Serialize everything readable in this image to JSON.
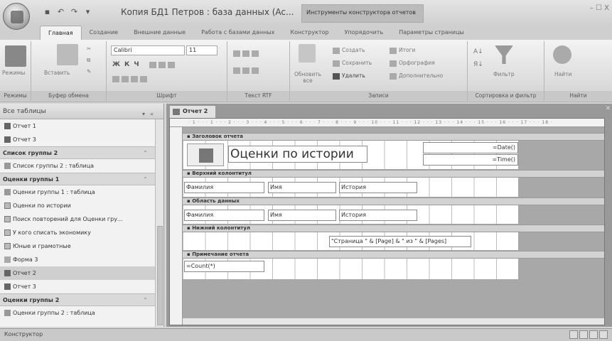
{
  "window": {
    "title": "Копия БД1 Петров : база данных (Ac...",
    "context_tab": "Инструменты конструктора отчетов",
    "controls": "– ☐ X"
  },
  "ribbon_tabs": [
    "Главная",
    "Создание",
    "Внешние данные",
    "Работа с базами данных",
    "Конструктор",
    "Упорядочить",
    "Параметры страницы"
  ],
  "ribbon": {
    "groups": [
      "Режимы",
      "Буфер обмена",
      "Шрифт",
      "Текст RTF",
      "Записи",
      "Сортировка и фильтр",
      "Найти"
    ],
    "rezhimy_btn": "Режимы",
    "vstavit_btn": "Вставить",
    "font_name": "Calibri",
    "font_size": "11",
    "obnovit_btn": "Обновить все",
    "sozdat": "Создать",
    "sohranit": "Сохранить",
    "udalit": "Удалить",
    "itogi": "Итоги",
    "orfografiya": "Орфография",
    "dopolnitelno": "Дополнительно",
    "filtr": "Фильтр",
    "nayti": "Найти"
  },
  "nav": {
    "header": "Все таблицы",
    "items_top": [
      "Отчет 1",
      "Отчет 3"
    ],
    "group1": "Список группы 2",
    "group1_items": [
      "Список группы 2 : таблица"
    ],
    "group2": "Оценки группы 1",
    "group2_items": [
      "Оценки группы 1 : таблица",
      "Оценки по истории",
      "Поиск повторений для Оценки гру...",
      "У кого списать экономику",
      "Юные и грамотные",
      "Форма 3",
      "Отчет 2",
      "Отчет 3"
    ],
    "group3": "Оценки группы 2",
    "group3_items": [
      "Оценки группы 2 : таблица"
    ]
  },
  "doc": {
    "tab": "Отчет 2",
    "ruler": "· 1 · · · 1 · · · 2 · · · 3 · · · 4 · · · 5 · · · 6 · · · 7 · · · 8 · · · 9 · · · 10 · · · 11 · · · 12 · · · 13 · · · 14 · · · 15 · · · 16 · · · 17 · · · 18 ·",
    "sections": {
      "report_header": "Заголовок отчета",
      "page_header": "Верхний колонтитул",
      "detail": "Область данных",
      "page_footer": "Нижний колонтитул",
      "report_footer": "Примечание отчета"
    },
    "title_label": "Оценки по истории",
    "date_ctrl": "=Date()",
    "time_ctrl": "=Time()",
    "ph_labels": [
      "Фамилия",
      "Имя",
      "История"
    ],
    "detail_fields": [
      "Фамилия",
      "Имя",
      "История"
    ],
    "page_expr": "\"Страница \" & [Page] & \" из \" & [Pages]",
    "count_expr": "=Count(*)"
  },
  "status": "Конструктор"
}
